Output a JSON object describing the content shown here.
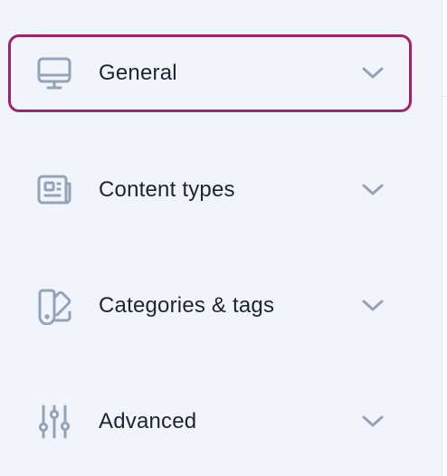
{
  "nav": {
    "items": [
      {
        "label": "General",
        "icon": "monitor-icon",
        "active": true
      },
      {
        "label": "Content types",
        "icon": "newspaper-icon",
        "active": false
      },
      {
        "label": "Categories & tags",
        "icon": "swatch-icon",
        "active": false
      },
      {
        "label": "Advanced",
        "icon": "sliders-icon",
        "active": false
      }
    ]
  },
  "colors": {
    "background": "#f1f4fa",
    "active_border": "#a3206a",
    "icon": "#94a3b8",
    "label": "#1c2434"
  }
}
